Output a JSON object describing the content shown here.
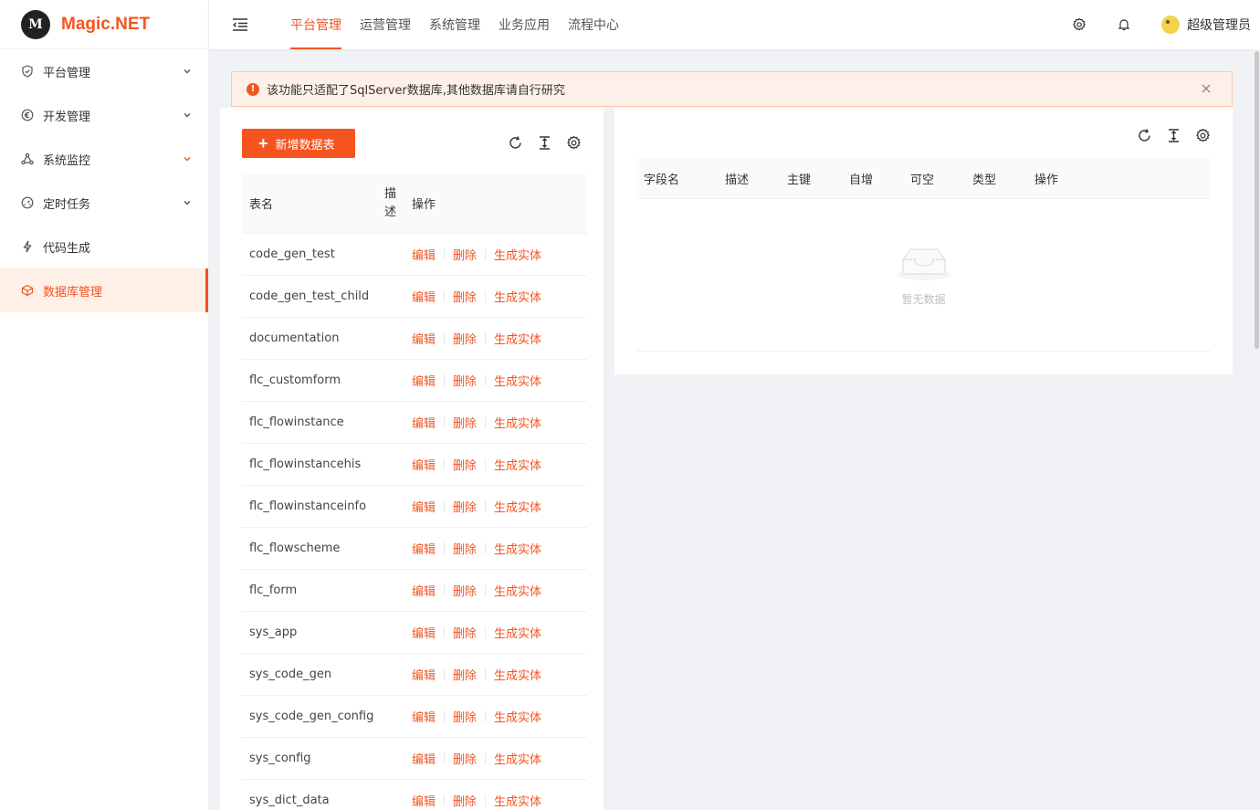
{
  "app": {
    "title": "Magic.NET",
    "logo_mark": "M"
  },
  "sidebar": {
    "items": [
      {
        "label": "平台管理",
        "icon": "shield-icon",
        "has_arrow": true
      },
      {
        "label": "开发管理",
        "icon": "euro-circle-icon",
        "has_arrow": true
      },
      {
        "label": "系统监控",
        "icon": "cluster-icon",
        "has_arrow": true
      },
      {
        "label": "定时任务",
        "icon": "dashboard-icon",
        "has_arrow": true
      },
      {
        "label": "代码生成",
        "icon": "thunderbolt-icon",
        "has_arrow": false
      },
      {
        "label": "数据库管理",
        "icon": "database-icon",
        "has_arrow": false,
        "active": true
      }
    ]
  },
  "header": {
    "tabs": [
      "平台管理",
      "运营管理",
      "系统管理",
      "业务应用",
      "流程中心"
    ],
    "active_tab": "平台管理",
    "user_name": "超级管理员"
  },
  "alert": {
    "text": "该功能只适配了SqlServer数据库,其他数据库请自行研究"
  },
  "left_table": {
    "add_button": "新增数据表",
    "columns": {
      "name": "表名",
      "desc_1": "描",
      "desc_2": "述",
      "action": "操作"
    },
    "action_labels": {
      "edit": "编辑",
      "delete": "删除",
      "gen": "生成实体"
    },
    "rows": [
      "code_gen_test",
      "code_gen_test_child",
      "documentation",
      "flc_customform",
      "flc_flowinstance",
      "flc_flowinstancehis",
      "flc_flowinstanceinfo",
      "flc_flowscheme",
      "flc_form",
      "sys_app",
      "sys_code_gen",
      "sys_code_gen_config",
      "sys_config",
      "sys_dict_data"
    ]
  },
  "right_table": {
    "columns": [
      "字段名",
      "描述",
      "主键",
      "自增",
      "可空",
      "类型",
      "操作"
    ],
    "empty_text": "暂无数据"
  },
  "colors": {
    "accent": "#f5541f",
    "alert_bg": "#fef0e8"
  }
}
